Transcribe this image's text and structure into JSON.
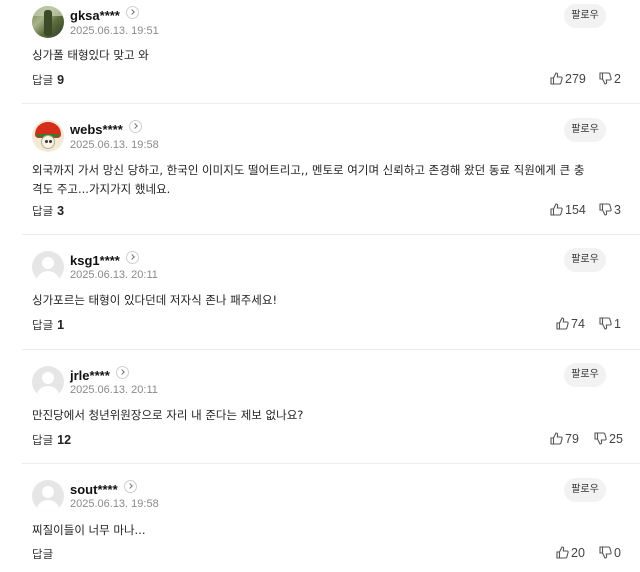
{
  "comments": [
    {
      "username": "gksa****",
      "date": "2025.06.13. 19:51",
      "follow_label": "팔로우",
      "text": "싱가폴 태형있다 맞고 와",
      "reply_label": "답글",
      "reply_count": "9",
      "likes": "279",
      "dislikes": "2",
      "avatar": "scenery"
    },
    {
      "username": "webs****",
      "date": "2025.06.13. 19:58",
      "follow_label": "팔로우",
      "text": "외국까지 가서 망신 당하고, 한국인 이미지도 떨어트리고,, 멘토로 여기며 신뢰하고 존경해 왔던 동료 직원에게 큰 충격도 주고...가지가지 했네요.",
      "reply_label": "답글",
      "reply_count": "3",
      "likes": "154",
      "dislikes": "3",
      "avatar": "character"
    },
    {
      "username": "ksg1****",
      "date": "2025.06.13. 20:11",
      "follow_label": "팔로우",
      "text": "싱가포르는 태형이 있다던데 저자식 존나 패주세요!",
      "reply_label": "답글",
      "reply_count": "1",
      "likes": "74",
      "dislikes": "1",
      "avatar": "default"
    },
    {
      "username": "jrle****",
      "date": "2025.06.13. 20:11",
      "follow_label": "팔로우",
      "text": "만진당에서 청년위원장으로 자리 내 준다는 제보 없나요?",
      "reply_label": "답글",
      "reply_count": "12",
      "likes": "79",
      "dislikes": "25",
      "avatar": "default"
    },
    {
      "username": "sout****",
      "date": "2025.06.13. 19:58",
      "follow_label": "팔로우",
      "text": "찌질이들이 너무 마나...",
      "reply_label": "답글",
      "reply_count": "",
      "likes": "20",
      "dislikes": "0",
      "avatar": "default"
    }
  ]
}
